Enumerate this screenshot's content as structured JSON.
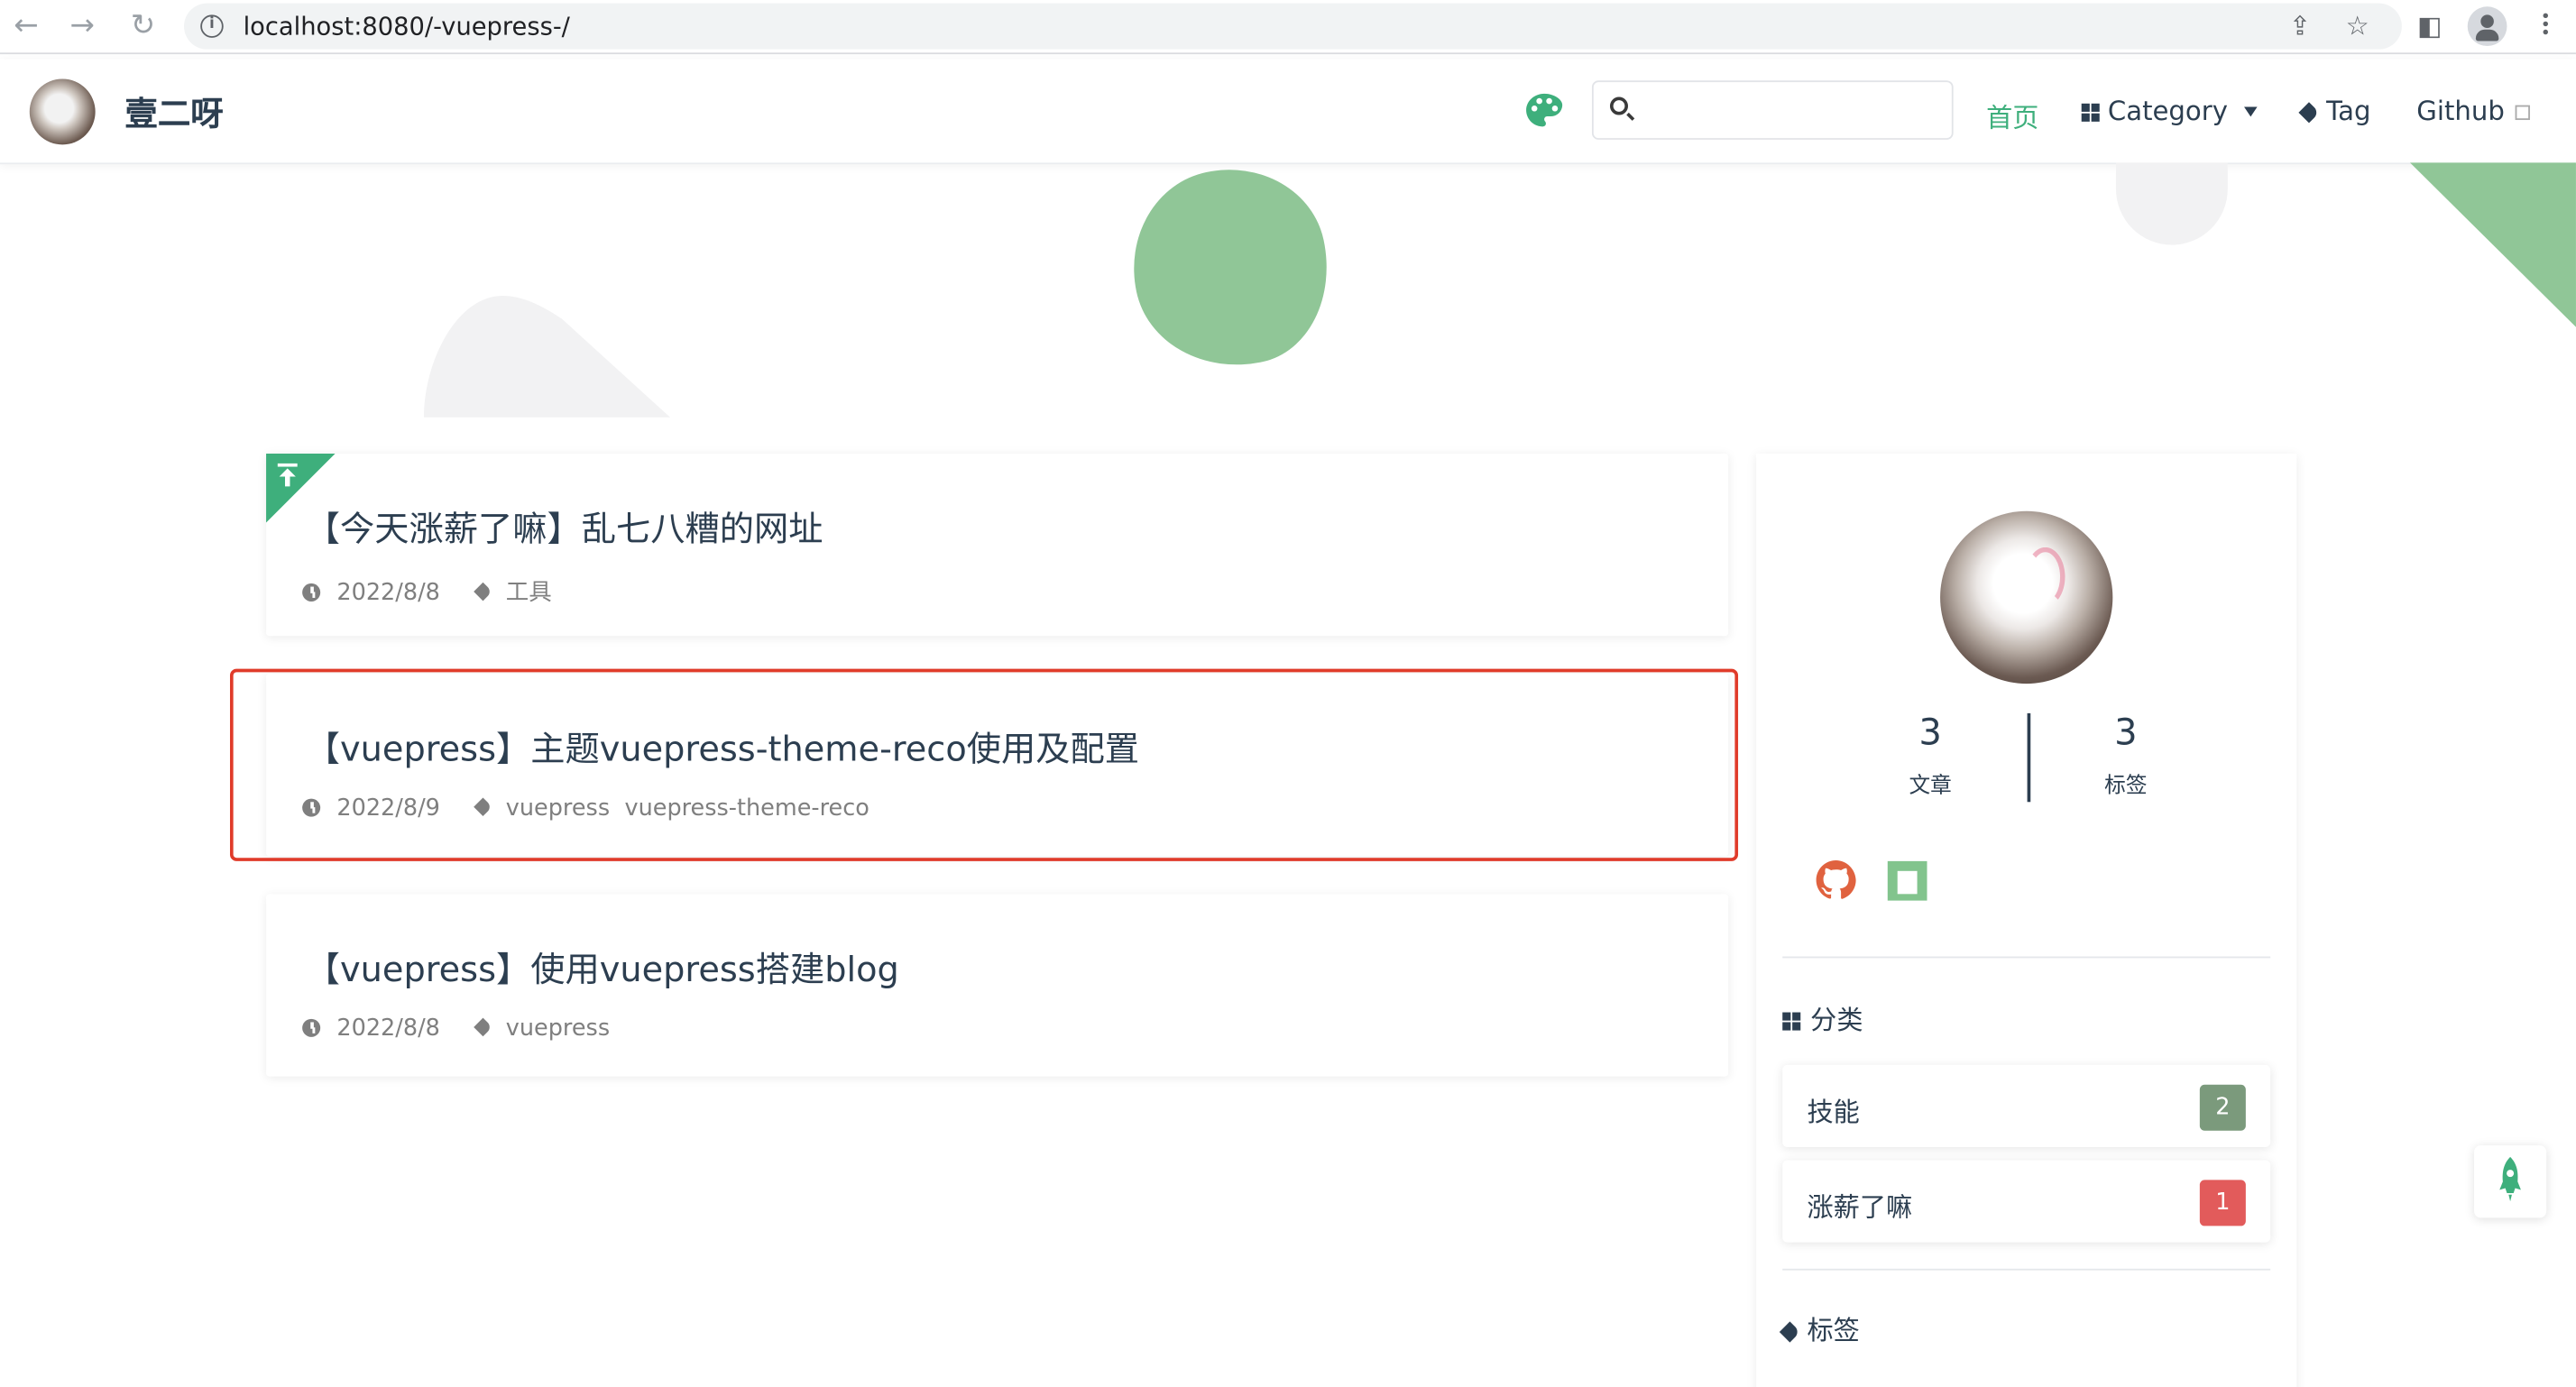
{
  "browser": {
    "url": "localhost:8080/-vuepress-/"
  },
  "navbar": {
    "site_name": "壹二呀",
    "search_placeholder": "",
    "links": {
      "home": "首页",
      "category": "Category",
      "tag": "Tag",
      "github": "Github"
    }
  },
  "articles": [
    {
      "title": "【今天涨薪了嘛】乱七八糟的网址",
      "date": "2022/8/8",
      "tags": [
        "工具"
      ],
      "sticky": true
    },
    {
      "title": "【vuepress】主题vuepress-theme-reco使用及配置",
      "date": "2022/8/9",
      "tags": [
        "vuepress",
        "vuepress-theme-reco"
      ],
      "sticky": false,
      "highlighted": true
    },
    {
      "title": "【vuepress】使用vuepress搭建blog",
      "date": "2022/8/8",
      "tags": [
        "vuepress"
      ],
      "sticky": false
    }
  ],
  "sidebar": {
    "stats": [
      {
        "value": "3",
        "label": "文章"
      },
      {
        "value": "3",
        "label": "标签"
      }
    ],
    "social_icons": [
      "github-icon",
      "npm-icon"
    ],
    "categories_title": "分类",
    "categories": [
      {
        "name": "技能",
        "count": "2",
        "color": "#7b9a7c"
      },
      {
        "name": "涨薪了嘛",
        "count": "1",
        "color": "#e25b5b"
      }
    ],
    "tags_title": "标签"
  },
  "colors": {
    "accent": "#3eaf7c",
    "decor_green": "#90c697",
    "highlight_border": "#e03b2a"
  }
}
